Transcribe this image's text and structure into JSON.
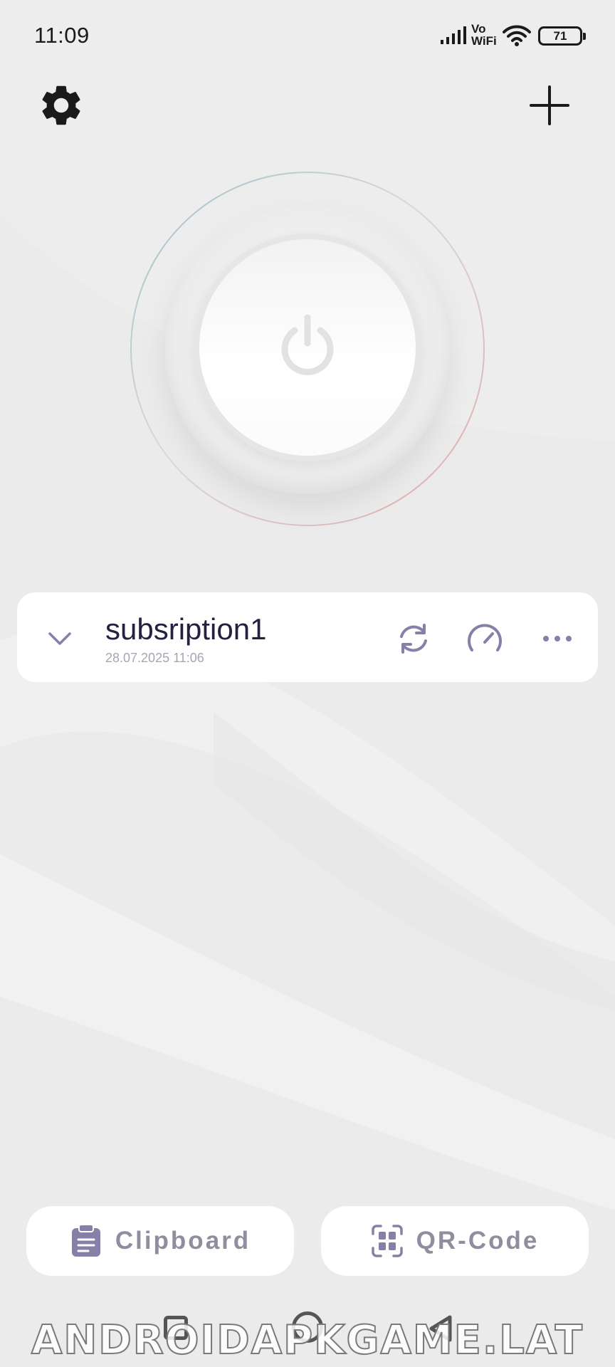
{
  "status_bar": {
    "time": "11:09",
    "network_label_top": "Vo",
    "network_label_bottom": "WiFi",
    "battery": "71",
    "icons": [
      "signal-icon",
      "vowifi-icon",
      "wifi-icon",
      "battery-icon"
    ]
  },
  "header": {
    "icons": [
      "gear-icon",
      "plus-icon"
    ]
  },
  "power": {
    "icon": "power-icon",
    "ring_colors": [
      "#9ec0c8",
      "#e2a8a8"
    ]
  },
  "subscription": {
    "name": "subsription1",
    "updated": "28.07.2025 11:06",
    "icons": [
      "chevron-down-icon",
      "refresh-icon",
      "speedometer-icon",
      "more-icon"
    ]
  },
  "bottom_actions": {
    "clipboard_label": "Clipboard",
    "qr_label": "QR-Code",
    "icons": [
      "clipboard-icon",
      "qr-code-icon"
    ]
  },
  "watermark": "ANDROIDAPKGAME.LAT",
  "colors": {
    "accent": "#8580a8",
    "text_dark": "#24203f",
    "text_muted": "#a7a5b3",
    "background": "#ebebeb"
  }
}
